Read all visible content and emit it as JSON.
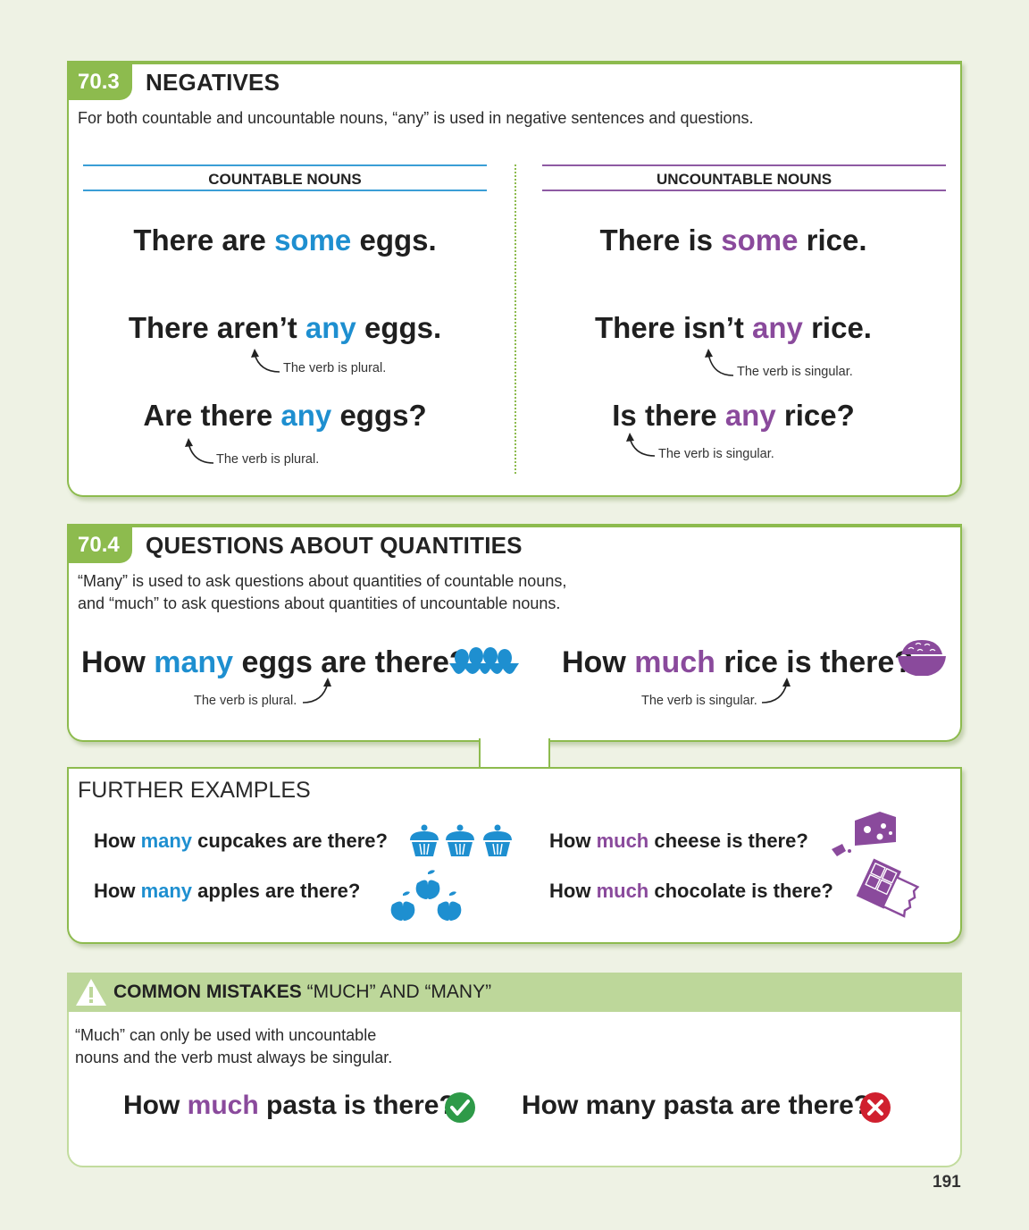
{
  "s703": {
    "number": "70.3",
    "title": "NEGATIVES",
    "intro": "For both countable and uncountable nouns, “any” is used in negative sentences and questions.",
    "countable": {
      "header": "COUNTABLE NOUNS",
      "s1": [
        "There are ",
        "some",
        " eggs."
      ],
      "s2": [
        "There aren’t ",
        "any",
        " eggs."
      ],
      "note2": "The verb is plural.",
      "s3": [
        "Are there ",
        "any",
        " eggs?"
      ],
      "note3": "The verb is plural."
    },
    "uncountable": {
      "header": "UNCOUNTABLE NOUNS",
      "s1": [
        "There is ",
        "some",
        " rice."
      ],
      "s2": [
        "There isn’t ",
        "any",
        " rice."
      ],
      "note2": "The verb is singular.",
      "s3": [
        "Is there ",
        "any",
        " rice?"
      ],
      "note3": "The verb is singular."
    }
  },
  "s704": {
    "number": "70.4",
    "title": "QUESTIONS ABOUT QUANTITIES",
    "intro_line1": "“Many” is used to ask questions about quantities of countable nouns,",
    "intro_line2": "and “much” to ask questions about quantities of uncountable nouns.",
    "q_left": [
      "How ",
      "many",
      " eggs are there?"
    ],
    "note_left": "The verb is plural.",
    "q_right": [
      "How ",
      "much",
      " rice is there?"
    ],
    "note_right": "The verb is singular."
  },
  "further": {
    "title": "FURTHER EXAMPLES",
    "ex1": [
      "How ",
      "many",
      " cupcakes are there?"
    ],
    "ex2": [
      "How ",
      "many",
      " apples are there?"
    ],
    "ex3": [
      "How ",
      "much",
      " cheese is there?"
    ],
    "ex4": [
      "How ",
      "much",
      " chocolate is there?"
    ]
  },
  "mistakes": {
    "title_bold": "COMMON MISTAKES",
    "title_rest": " “MUCH” AND “MANY”",
    "text_line1": "“Much” can only be used with uncountable",
    "text_line2": "nouns and the verb must always be singular.",
    "correct": [
      "How ",
      "much",
      " pasta is there?"
    ],
    "wrong": "How many pasta are there?"
  },
  "page_number": "191",
  "colors": {
    "green": "#8dbb4e",
    "blue": "#1e8fd0",
    "purple": "#8a4a9c",
    "check": "#2e9a48",
    "cross": "#d0202f"
  },
  "icons": [
    "egg-carton-icon",
    "rice-bowl-icon",
    "cupcake-icon",
    "apple-icon",
    "cheese-icon",
    "chocolate-icon",
    "warning-icon",
    "checkmark-icon",
    "cross-icon"
  ]
}
